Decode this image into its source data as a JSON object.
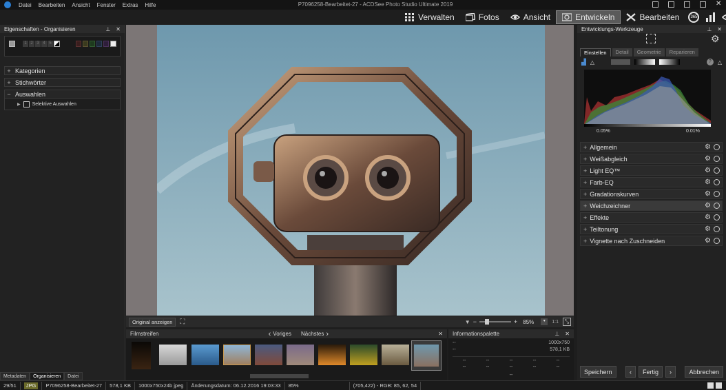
{
  "menu": [
    "Datei",
    "Bearbeiten",
    "Ansicht",
    "Fenster",
    "Extras",
    "Hilfe"
  ],
  "window_title": "P7096258-Bearbeitet-27 - ACDSee Photo Studio Ultimate 2019",
  "modes": {
    "verwalten": "Verwalten",
    "fotos": "Fotos",
    "ansicht": "Ansicht",
    "entwickeln": "Entwickeln",
    "bearbeiten": "Bearbeiten",
    "badge": "365"
  },
  "left": {
    "title": "Eigenschaften - Organisieren",
    "ratings": [
      "1",
      "2",
      "3",
      "4",
      "5"
    ],
    "sections": [
      "Kategorien",
      "Stichwörter",
      "Auswahlen"
    ],
    "auswahlen_item": "Selektive Auswahlen",
    "tabs": [
      "Metadaten",
      "Organisieren",
      "Datei"
    ]
  },
  "viewer": {
    "original_btn": "Original anzeigen",
    "zoom": "85%",
    "ratio": "1:1"
  },
  "filmstrip": {
    "title": "Filmstreifen",
    "prev": "Voriges",
    "next": "Nächstes"
  },
  "info": {
    "title": "Informationspalette",
    "dash": "--",
    "dims": "1000x750",
    "size": "578,1 KB"
  },
  "right": {
    "title": "Entwicklungs-Werkzeuge",
    "tabs": [
      "Einstellen",
      "Detail",
      "Geometrie",
      "Reparieren"
    ],
    "hist_left": "0.05%",
    "hist_right": "0.01%",
    "tools": [
      "Allgemein",
      "Weißabgleich",
      "Light EQ™",
      "Farb-EQ",
      "Gradationskurven",
      "Weichzeichner",
      "Effekte",
      "Teiltonung",
      "Vignette nach Zuschneiden"
    ],
    "save": "Speichern",
    "done": "Fertig",
    "cancel": "Abbrechen"
  },
  "status": {
    "count": "29/51",
    "format": "JPG",
    "filename": "P7096258-Bearbeitet-27",
    "filesize": "578,1 KB",
    "dims": "1000x750x24b jpeg",
    "date": "Änderungsdatum: 06.12.2016 19:03:33",
    "zoom": "85%",
    "pixel": "(705,422) - RGB: 85, 62, 54"
  },
  "colors": {
    "accent": "#2a7fd4",
    "sky": "#6f9bb0"
  }
}
